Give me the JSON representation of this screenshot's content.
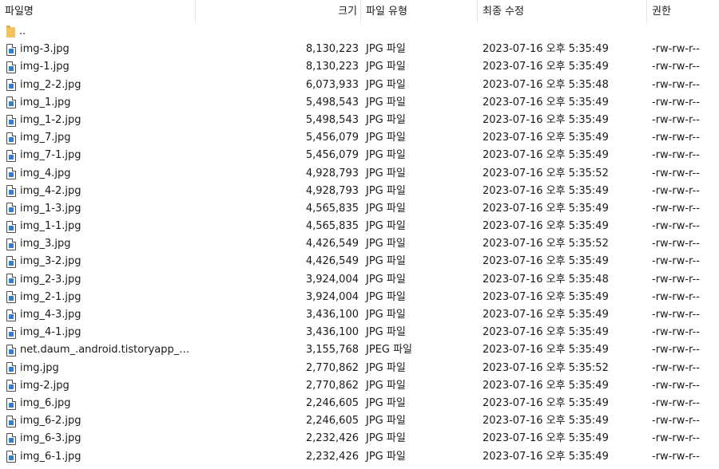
{
  "columns": {
    "name": "파일명",
    "size": "크기",
    "type": "파일 유형",
    "modified": "최종 수정",
    "permissions": "권한"
  },
  "sort_indicator": "⌄",
  "parent_row": {
    "name": "..",
    "icon": "folder-icon"
  },
  "files": [
    {
      "name": "img-3.jpg",
      "size": "8,130,223",
      "type": "JPG 파일",
      "modified": "2023-07-16 오후 5:35:49",
      "perm": "-rw-rw-r--"
    },
    {
      "name": "img-1.jpg",
      "size": "8,130,223",
      "type": "JPG 파일",
      "modified": "2023-07-16 오후 5:35:49",
      "perm": "-rw-rw-r--"
    },
    {
      "name": "img_2-2.jpg",
      "size": "6,073,933",
      "type": "JPG 파일",
      "modified": "2023-07-16 오후 5:35:48",
      "perm": "-rw-rw-r--"
    },
    {
      "name": "img_1.jpg",
      "size": "5,498,543",
      "type": "JPG 파일",
      "modified": "2023-07-16 오후 5:35:49",
      "perm": "-rw-rw-r--"
    },
    {
      "name": "img_1-2.jpg",
      "size": "5,498,543",
      "type": "JPG 파일",
      "modified": "2023-07-16 오후 5:35:49",
      "perm": "-rw-rw-r--"
    },
    {
      "name": "img_7.jpg",
      "size": "5,456,079",
      "type": "JPG 파일",
      "modified": "2023-07-16 오후 5:35:49",
      "perm": "-rw-rw-r--"
    },
    {
      "name": "img_7-1.jpg",
      "size": "5,456,079",
      "type": "JPG 파일",
      "modified": "2023-07-16 오후 5:35:49",
      "perm": "-rw-rw-r--"
    },
    {
      "name": "img_4.jpg",
      "size": "4,928,793",
      "type": "JPG 파일",
      "modified": "2023-07-16 오후 5:35:52",
      "perm": "-rw-rw-r--"
    },
    {
      "name": "img_4-2.jpg",
      "size": "4,928,793",
      "type": "JPG 파일",
      "modified": "2023-07-16 오후 5:35:49",
      "perm": "-rw-rw-r--"
    },
    {
      "name": "img_1-3.jpg",
      "size": "4,565,835",
      "type": "JPG 파일",
      "modified": "2023-07-16 오후 5:35:49",
      "perm": "-rw-rw-r--"
    },
    {
      "name": "img_1-1.jpg",
      "size": "4,565,835",
      "type": "JPG 파일",
      "modified": "2023-07-16 오후 5:35:49",
      "perm": "-rw-rw-r--"
    },
    {
      "name": "img_3.jpg",
      "size": "4,426,549",
      "type": "JPG 파일",
      "modified": "2023-07-16 오후 5:35:52",
      "perm": "-rw-rw-r--"
    },
    {
      "name": "img_3-2.jpg",
      "size": "4,426,549",
      "type": "JPG 파일",
      "modified": "2023-07-16 오후 5:35:49",
      "perm": "-rw-rw-r--"
    },
    {
      "name": "img_2-3.jpg",
      "size": "3,924,004",
      "type": "JPG 파일",
      "modified": "2023-07-16 오후 5:35:48",
      "perm": "-rw-rw-r--"
    },
    {
      "name": "img_2-1.jpg",
      "size": "3,924,004",
      "type": "JPG 파일",
      "modified": "2023-07-16 오후 5:35:49",
      "perm": "-rw-rw-r--"
    },
    {
      "name": "img_4-3.jpg",
      "size": "3,436,100",
      "type": "JPG 파일",
      "modified": "2023-07-16 오후 5:35:49",
      "perm": "-rw-rw-r--"
    },
    {
      "name": "img_4-1.jpg",
      "size": "3,436,100",
      "type": "JPG 파일",
      "modified": "2023-07-16 오후 5:35:49",
      "perm": "-rw-rw-r--"
    },
    {
      "name": "net.daum_.android.tistoryapp_20...",
      "size": "3,155,768",
      "type": "JPEG 파일",
      "modified": "2023-07-16 오후 5:35:49",
      "perm": "-rw-rw-r--"
    },
    {
      "name": "img.jpg",
      "size": "2,770,862",
      "type": "JPG 파일",
      "modified": "2023-07-16 오후 5:35:52",
      "perm": "-rw-rw-r--"
    },
    {
      "name": "img-2.jpg",
      "size": "2,770,862",
      "type": "JPG 파일",
      "modified": "2023-07-16 오후 5:35:49",
      "perm": "-rw-rw-r--"
    },
    {
      "name": "img_6.jpg",
      "size": "2,246,605",
      "type": "JPG 파일",
      "modified": "2023-07-16 오후 5:35:49",
      "perm": "-rw-rw-r--"
    },
    {
      "name": "img_6-2.jpg",
      "size": "2,246,605",
      "type": "JPG 파일",
      "modified": "2023-07-16 오후 5:35:49",
      "perm": "-rw-rw-r--"
    },
    {
      "name": "img_6-3.jpg",
      "size": "2,232,426",
      "type": "JPG 파일",
      "modified": "2023-07-16 오후 5:35:49",
      "perm": "-rw-rw-r--"
    },
    {
      "name": "img_6-1.jpg",
      "size": "2,232,426",
      "type": "JPG 파일",
      "modified": "2023-07-16 오후 5:35:49",
      "perm": "-rw-rw-r--"
    }
  ]
}
